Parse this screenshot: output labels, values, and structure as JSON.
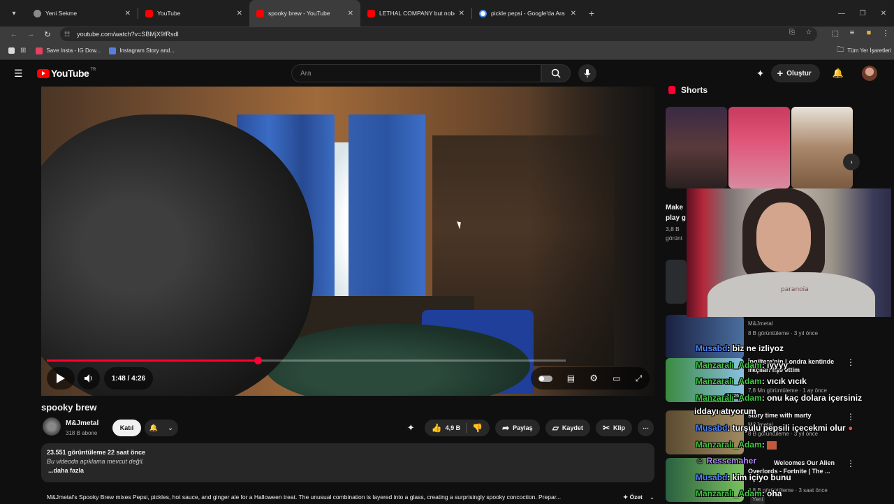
{
  "browser": {
    "tabs": [
      {
        "title": "Yeni Sekme",
        "fav": "#8a8a8a"
      },
      {
        "title": "YouTube",
        "fav": "#ff0000"
      },
      {
        "title": "spooky brew - YouTube",
        "fav": "#ff0000"
      },
      {
        "title": "LETHAL COMPANY but nobody",
        "fav": "#ff0000"
      },
      {
        "title": "pickle pepsi - Google'da Ara",
        "fav": "#4285f4"
      }
    ],
    "url": "youtube.com/watch?v=SBMjX9fRsdI",
    "bookmarks": [
      {
        "label": "Save Insta - IG Dow..."
      },
      {
        "label": "Instagram Story and..."
      }
    ],
    "all_bookmarks": "Tüm Yer İşaretleri"
  },
  "youtube": {
    "logo": "YouTube",
    "country": "TR",
    "search_placeholder": "Ara",
    "create_label": "Oluştur"
  },
  "player": {
    "time": "1:48 / 4:26",
    "progress": 0.406,
    "colors": {
      "progress": "#ff0033"
    }
  },
  "video": {
    "title": "spooky brew",
    "channel": "M&Jmetal",
    "subscribers": "318 B abone",
    "join": "Katıl",
    "likes": "4,9 B",
    "share": "Paylaş",
    "save": "Kaydet",
    "clip": "Klip",
    "stats": "23.551 görüntüleme  22 saat önce",
    "no_description": "Bu videoda açıklama mevcut değil.",
    "more": "...daha fazla",
    "summary": "M&Jmetal's Spooky Brew mixes Pepsi, pickles, hot sauce, and ginger ale for a Halloween treat. The unusual combination is layered into a glass, creating a surprisingly spooky concoction. Prepar...",
    "summary_button": "Özet"
  },
  "sidebar": {
    "shorts_title": "Shorts",
    "short_card": {
      "title_line1": "Make",
      "title_line2": "play g",
      "views_line1": "3,8 B",
      "views_line2": "görünt"
    },
    "recs": [
      {
        "channel": "M&Jmetal",
        "meta": "8 B görüntüleme · 3 yıl önce"
      },
      {
        "title": "İngiltere'nin Londra kentinde",
        "title2": "irkçıları fişe ettim",
        "meta": "7,8 Mn görüntüleme · 1 ay önce",
        "duration": "31:26"
      },
      {
        "title": "story time with marty",
        "channel": "M&Jmetal",
        "meta": "8 B görüntüleme · 3 yıl önce"
      },
      {
        "title": "Welcomes Our Alien",
        "title2": "Overlords - Fortnite | The ...",
        "meta": "4,8 B görüntüleme · 3 saat önce",
        "badge": "Yeni"
      }
    ]
  },
  "chat": [
    {
      "user": "Musabd",
      "msg": ": biz ne izliyoz"
    },
    {
      "user": "Manzaralı_Adam",
      "msg": ": iyyyy"
    },
    {
      "user": "Manzaralı_Adam",
      "msg": ": vıcık vıcık"
    },
    {
      "user": "Manzaralı_Adam",
      "msg": ": onu kaç dolara içersiniz"
    },
    {
      "user": "",
      "msg": "iddayı atıyorum"
    },
    {
      "user": "Musabd",
      "msg": ": turşulu pepsili içecekmi olur"
    },
    {
      "user": "Manzaralı_Adam",
      "msg": ":"
    },
    {
      "user": "Ressemaher",
      "msg": ""
    },
    {
      "user": "Musabd",
      "msg": ": kim içiyo bunu"
    },
    {
      "user": "Manzaralı_Adam",
      "msg": ": oha"
    }
  ]
}
